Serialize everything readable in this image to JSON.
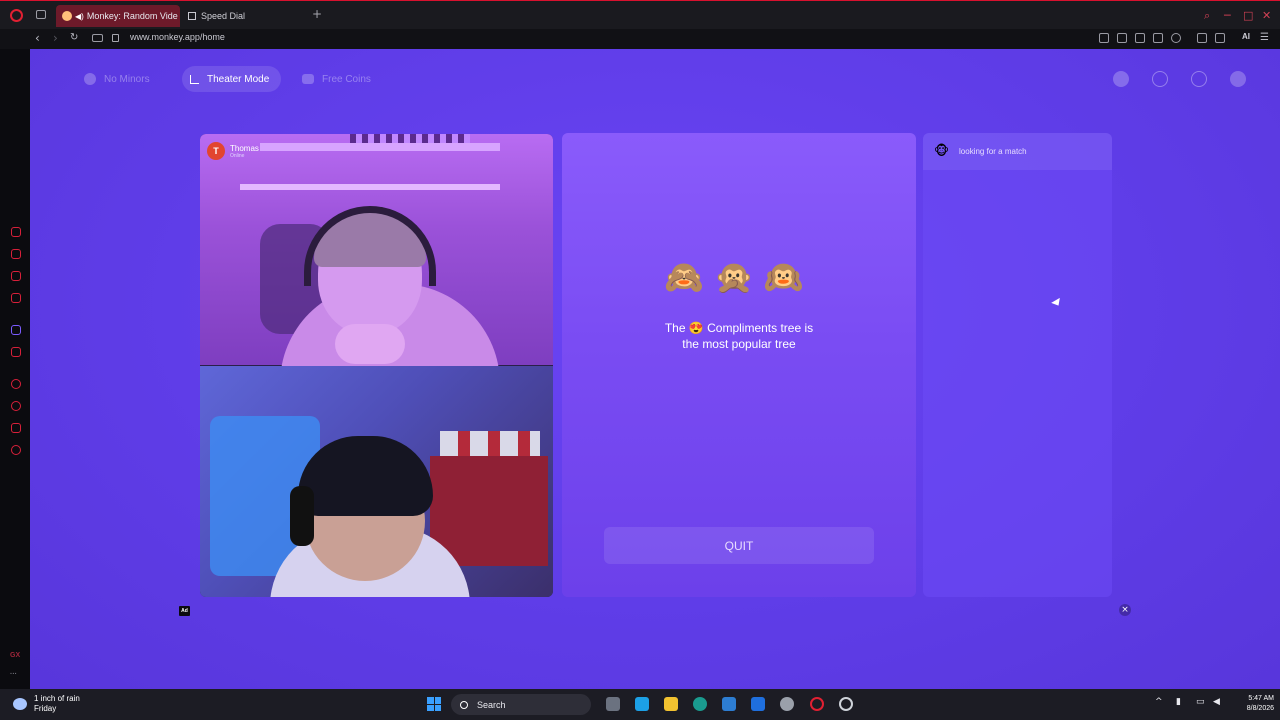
{
  "browser": {
    "tabs": [
      {
        "label": "Monkey: Random Vide",
        "active": true
      },
      {
        "label": "Speed Dial",
        "active": false
      }
    ],
    "new_tab": "+",
    "url": "www.monkey.app/home",
    "ai_label": "AI",
    "window_controls": [
      "─",
      "□",
      "✕"
    ]
  },
  "sidebar": {
    "bottom_label": "GX",
    "more": "···"
  },
  "topnav": {
    "no_minors": "No Minors",
    "theater_mode": "Theater Mode",
    "free_coins": "Free Coins"
  },
  "video": {
    "user_initial": "T",
    "user_name": "Thomas",
    "user_status": "Online",
    "ad_label": "Ad"
  },
  "card": {
    "monkeys": "🙈🙊🙉",
    "tip_line1": "The 😍 Compliments tree is",
    "tip_line2": "the most popular tree",
    "quit_label": "QUIT"
  },
  "side": {
    "match_icon": "🐵",
    "match_label": "looking for a match"
  },
  "close_label": "×",
  "taskbar": {
    "weather_line1": "1 inch of rain",
    "weather_line2": "Friday",
    "search_label": "Search",
    "time": "5:47 AM",
    "date": "8/8/2026"
  }
}
